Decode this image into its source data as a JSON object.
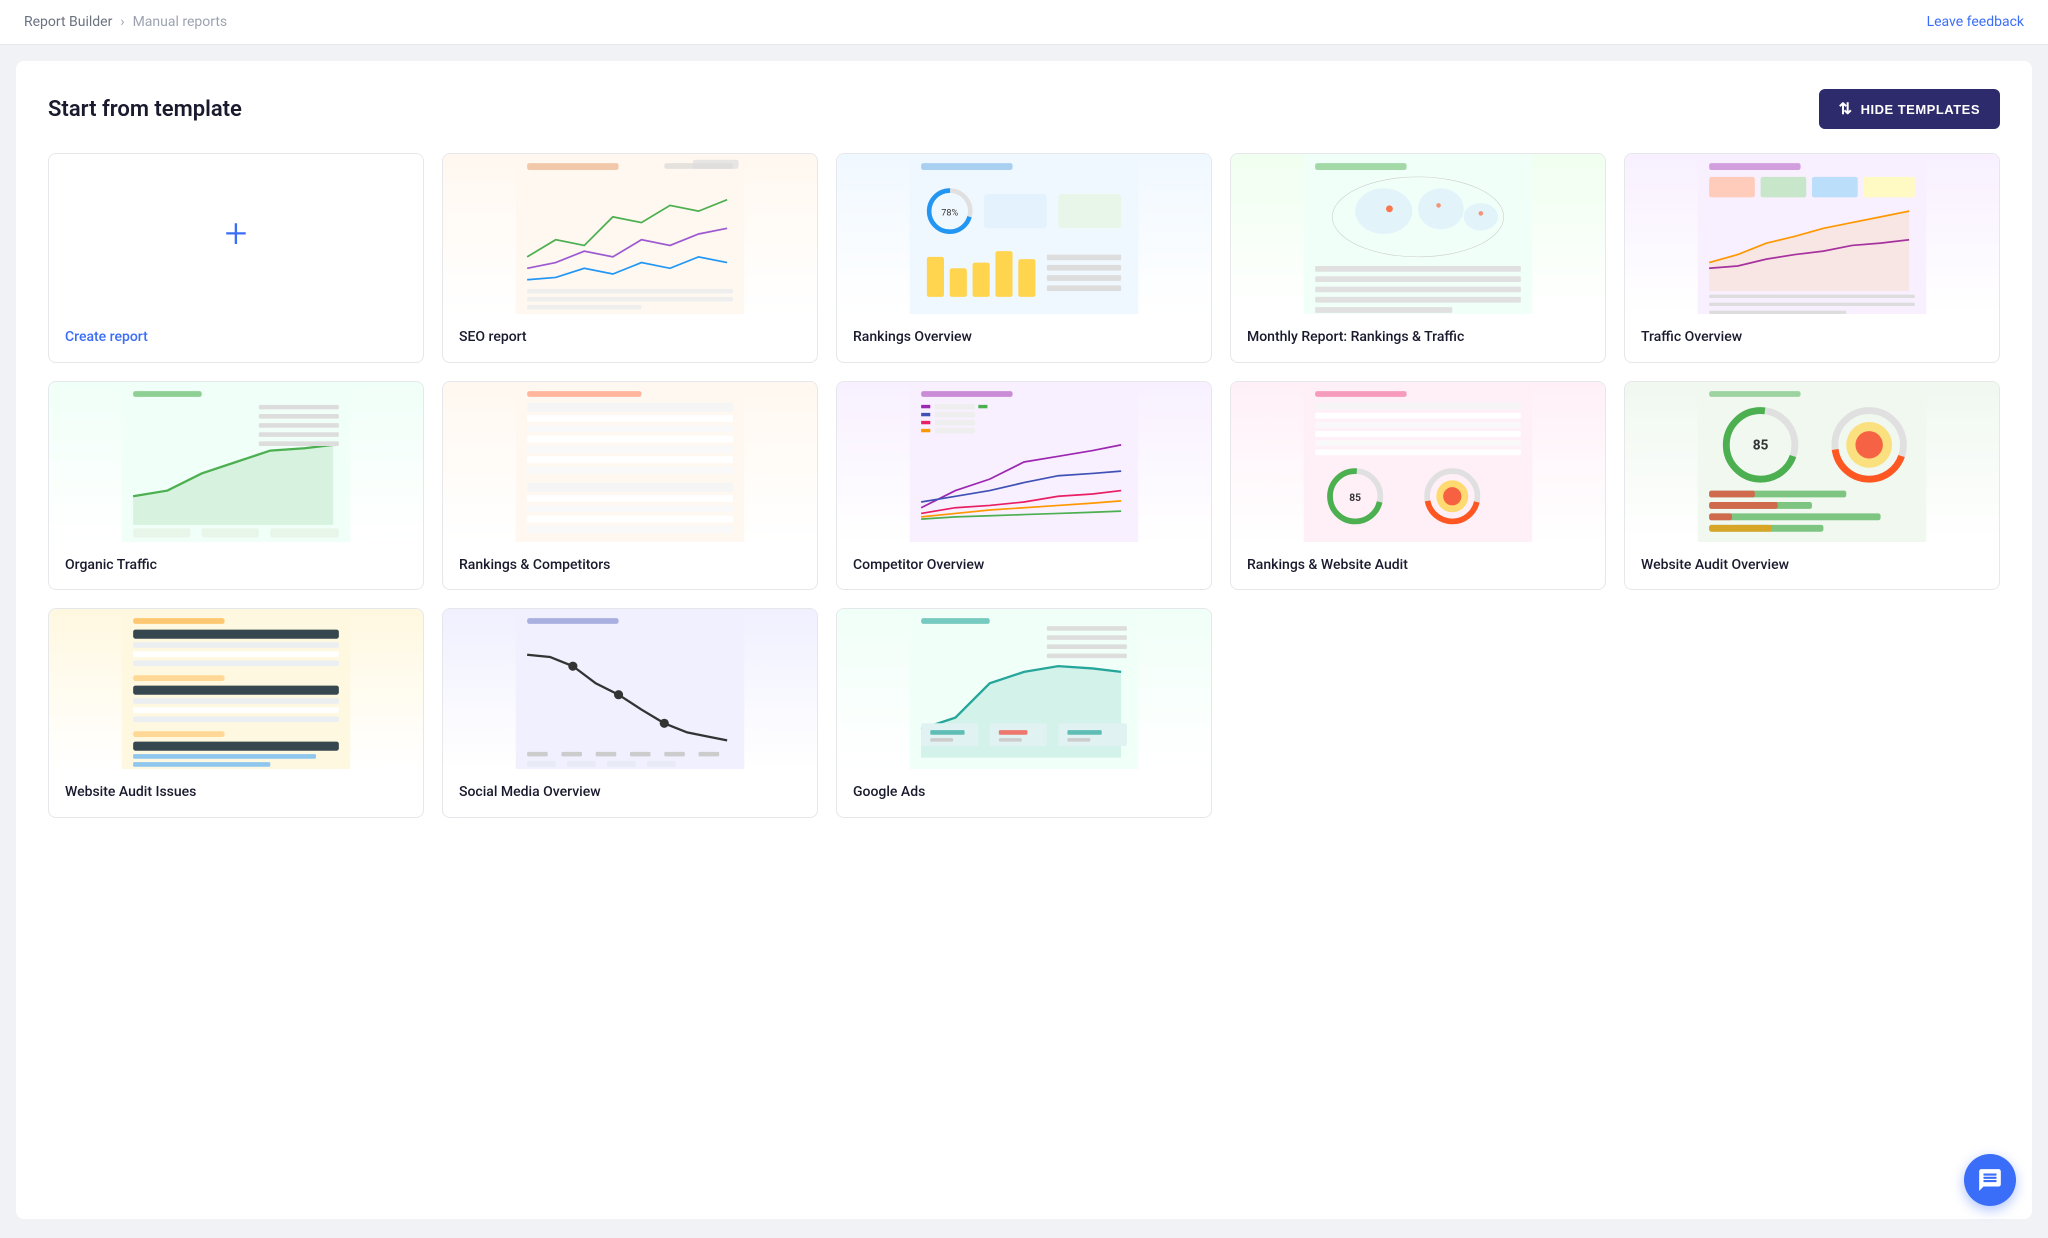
{
  "topbar": {
    "breadcrumb_root": "Report Builder",
    "breadcrumb_current": "Manual reports",
    "leave_feedback": "Leave feedback"
  },
  "main": {
    "section_title": "Start from template",
    "hide_templates_btn": "HIDE TEMPLATES"
  },
  "templates": [
    {
      "id": "create",
      "label": "Create report",
      "type": "create"
    },
    {
      "id": "seo",
      "label": "SEO report",
      "type": "seo"
    },
    {
      "id": "rankings-overview",
      "label": "Rankings Overview",
      "type": "rankings"
    },
    {
      "id": "monthly-report",
      "label": "Monthly Report: Rankings & Traffic",
      "type": "monthly"
    },
    {
      "id": "traffic-overview",
      "label": "Traffic Overview",
      "type": "traffic"
    },
    {
      "id": "organic-traffic",
      "label": "Organic Traffic",
      "type": "organic"
    },
    {
      "id": "rankings-competitors",
      "label": "Rankings & Competitors",
      "type": "rankcomp"
    },
    {
      "id": "competitor-overview",
      "label": "Competitor Overview",
      "type": "competitor"
    },
    {
      "id": "rankings-website-audit",
      "label": "Rankings & Website Audit",
      "type": "rankaudit"
    },
    {
      "id": "website-audit-overview",
      "label": "Website Audit Overview",
      "type": "websiteaudit"
    },
    {
      "id": "website-audit-issues",
      "label": "Website Audit Issues",
      "type": "websiteissues"
    },
    {
      "id": "social-media-overview",
      "label": "Social Media Overview",
      "type": "socialmedia"
    },
    {
      "id": "google-ads",
      "label": "Google Ads",
      "type": "googleads"
    }
  ]
}
